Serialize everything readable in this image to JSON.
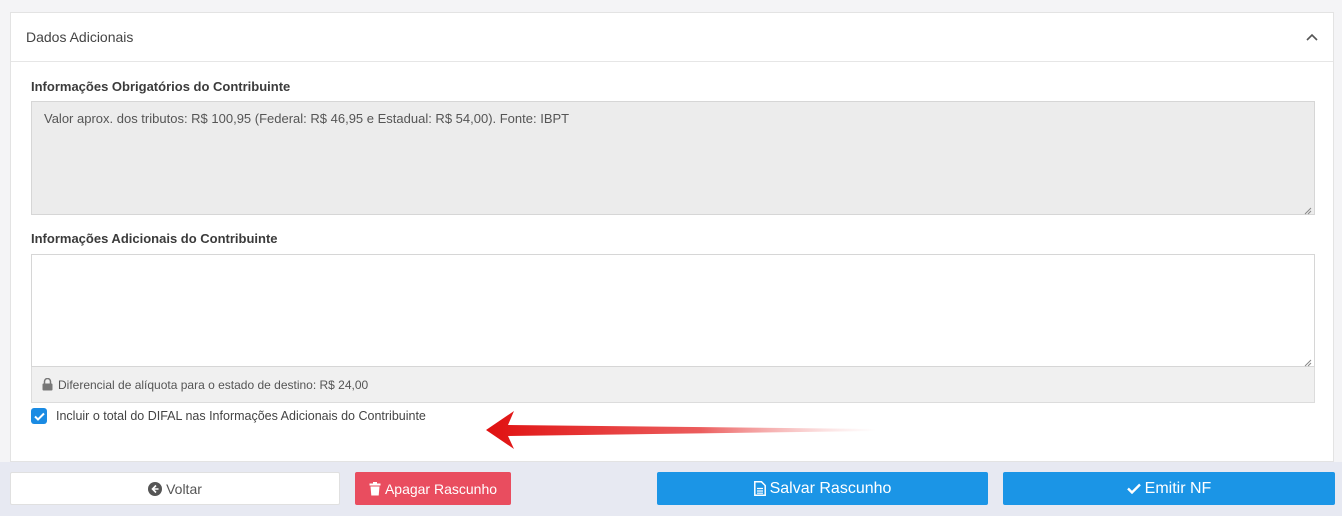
{
  "section": {
    "title": "Dados Adicionais",
    "collapse_icon": "chevron-up-icon"
  },
  "mandatory_info": {
    "label": "Informações Obrigatórios do Contribuinte",
    "value": "Valor aprox. dos tributos: R$ 100,95 (Federal: R$ 46,95 e Estadual: R$ 54,00). Fonte: IBPT"
  },
  "additional_info": {
    "label": "Informações Adicionais do Contribuinte",
    "value": "",
    "helper_icon": "lock-icon",
    "helper_text": "Diferencial de alíquota para o estado de destino: R$ 24,00"
  },
  "difal_checkbox": {
    "checked": true,
    "label": "Incluir o total do DIFAL nas Informações Adicionais do Contribuinte"
  },
  "footer": {
    "back_label": "Voltar",
    "delete_label": "Apagar Rascunho",
    "save_label": "Salvar Rascunho",
    "emit_label": "Emitir NF"
  },
  "colors": {
    "primary": "#1b95e6",
    "danger": "#e94d5f",
    "annotation_arrow": "#e01010"
  }
}
